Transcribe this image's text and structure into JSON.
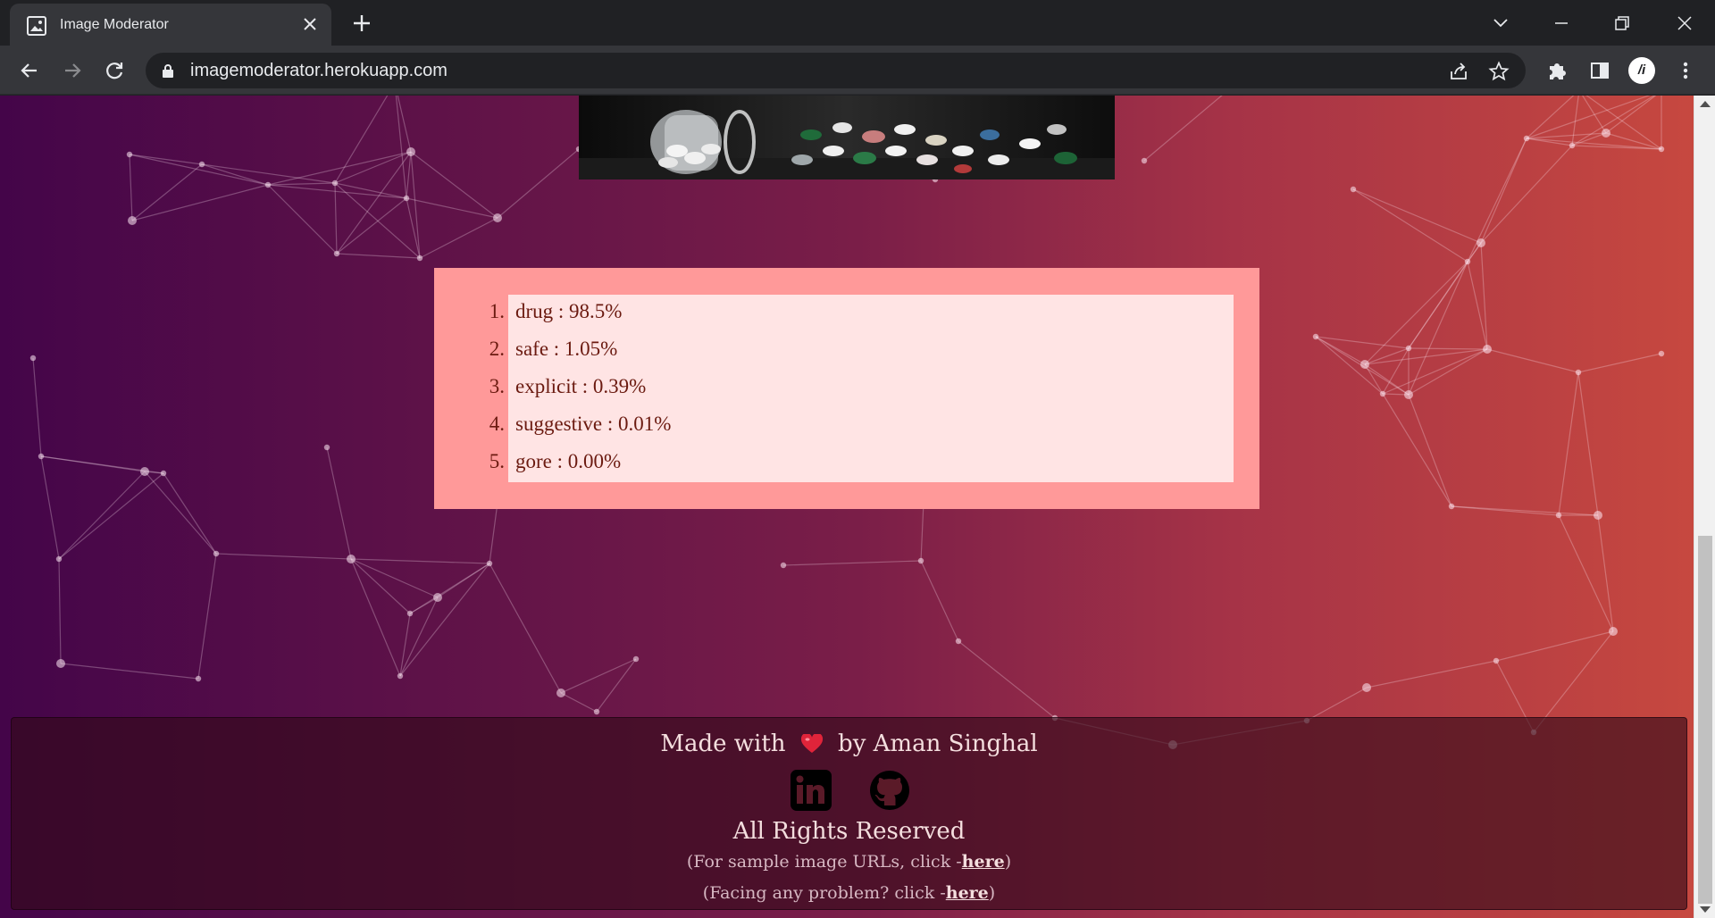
{
  "browser": {
    "tab_title": "Image Moderator",
    "url": "imagemoderator.herokuapp.com",
    "profile_initial": "/i"
  },
  "results": {
    "items": [
      {
        "num": "1.",
        "text": "drug : 98.5%"
      },
      {
        "num": "2.",
        "text": "safe : 1.05%"
      },
      {
        "num": "3.",
        "text": "explicit : 0.39%"
      },
      {
        "num": "4.",
        "text": "suggestive : 0.01%"
      },
      {
        "num": "5.",
        "text": "gore : 0.00%"
      }
    ]
  },
  "footer": {
    "made_prefix": "Made with",
    "made_suffix": "by Aman Singhal",
    "rights": "All Rights Reserved",
    "sample_prefix": "(For sample image URLs, click -",
    "sample_link": "here",
    "sample_suffix": ")",
    "problem_prefix": "(Facing any problem? click -",
    "problem_link": "here",
    "problem_suffix": ")"
  },
  "colors": {
    "results_bg": "#ff9999",
    "results_inner": "#ffe4e4",
    "result_text": "#6b1a10"
  },
  "icons": [
    "image-icon",
    "close-icon",
    "plus-icon",
    "chevron-down-icon",
    "minimize-icon",
    "restore-icon",
    "back-arrow-icon",
    "forward-arrow-icon",
    "reload-icon",
    "lock-icon",
    "share-icon",
    "star-icon",
    "puzzle-icon",
    "sidebar-icon",
    "menu-dots-icon",
    "heart-icon",
    "linkedin-icon",
    "github-icon"
  ]
}
